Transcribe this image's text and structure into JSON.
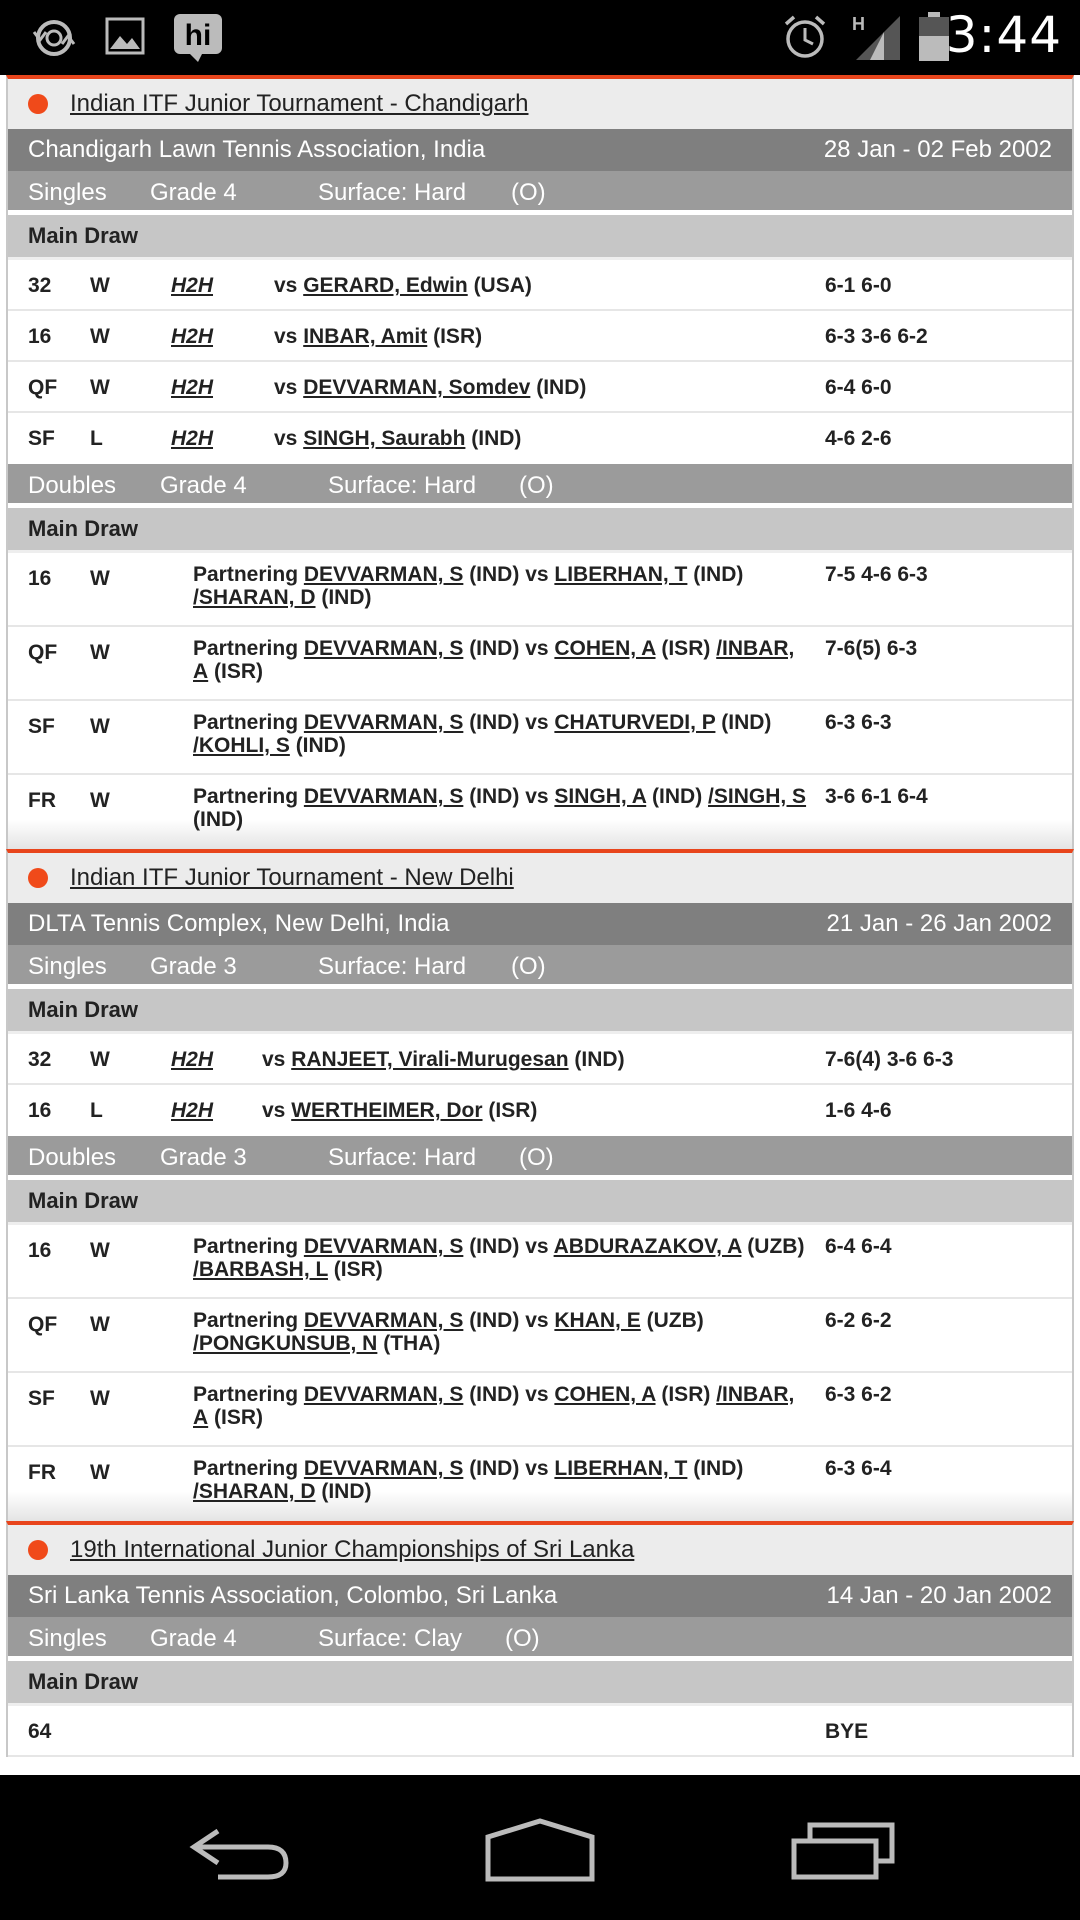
{
  "status_bar": {
    "time": "3:44",
    "signal_label": "H",
    "icons": [
      "sync-icon",
      "gallery-icon",
      "hi-app-icon",
      "alarm-icon",
      "signal-icon",
      "battery-icon"
    ]
  },
  "tournaments": [
    {
      "title": "Indian ITF Junior Tournament - Chandigarh",
      "venue": "Chandigarh Lawn Tennis Association, India",
      "dates": "28 Jan - 02 Feb 2002",
      "singles": {
        "event": "Singles",
        "grade": "Grade 4",
        "surface": "Surface: Hard",
        "io": "(O)",
        "draw": "Main Draw",
        "matches": [
          {
            "round": "32",
            "result": "W",
            "h2h": "H2H",
            "vs": "vs",
            "opponent": "GERARD, Edwin",
            "country": "(USA)",
            "score": "6-1 6-0"
          },
          {
            "round": "16",
            "result": "W",
            "h2h": "H2H",
            "vs": "vs",
            "opponent": "INBAR, Amit",
            "country": "(ISR)",
            "score": "6-3 3-6 6-2"
          },
          {
            "round": "QF",
            "result": "W",
            "h2h": "H2H",
            "vs": "vs",
            "opponent": "DEVVARMAN, Somdev",
            "country": "(IND)",
            "score": "6-4 6-0"
          },
          {
            "round": "SF",
            "result": "L",
            "h2h": "H2H",
            "vs": "vs",
            "opponent": "SINGH, Saurabh",
            "country": "(IND)",
            "score": "4-6 2-6"
          }
        ]
      },
      "doubles": {
        "event": "Doubles",
        "grade": "Grade 4",
        "surface": "Surface: Hard",
        "io": "(O)",
        "draw": "Main Draw",
        "matches": [
          {
            "round": "16",
            "result": "W",
            "partnering": "Partnering",
            "partner": "DEVVARMAN, S",
            "partner_country": "(IND)",
            "vs": "vs",
            "opp1": "LIBERHAN, T",
            "opp1_country": "(IND)",
            "opp2": "/SHARAN, D",
            "opp2_country": "(IND)",
            "score": "7-5 4-6 6-3"
          },
          {
            "round": "QF",
            "result": "W",
            "partnering": "Partnering",
            "partner": "DEVVARMAN, S",
            "partner_country": "(IND)",
            "vs": "vs",
            "opp1": "COHEN, A",
            "opp1_country": "(ISR)",
            "opp2": "/INBAR, A",
            "opp2_country": "(ISR)",
            "score": "7-6(5) 6-3"
          },
          {
            "round": "SF",
            "result": "W",
            "partnering": "Partnering",
            "partner": "DEVVARMAN, S",
            "partner_country": "(IND)",
            "vs": "vs",
            "opp1": "CHATURVEDI, P",
            "opp1_country": "(IND)",
            "opp2": "/KOHLI, S",
            "opp2_country": "(IND)",
            "score": "6-3 6-3"
          },
          {
            "round": "FR",
            "result": "W",
            "partnering": "Partnering",
            "partner": "DEVVARMAN, S",
            "partner_country": "(IND)",
            "vs": "vs",
            "opp1": "SINGH, A",
            "opp1_country": "(IND)",
            "opp2": "/SINGH, S",
            "opp2_country": "(IND)",
            "score": "3-6 6-1 6-4"
          }
        ]
      }
    },
    {
      "title": "Indian ITF Junior Tournament - New Delhi",
      "venue": "DLTA Tennis Complex, New Delhi, India",
      "dates": "21 Jan - 26 Jan 2002",
      "singles": {
        "event": "Singles",
        "grade": "Grade 3",
        "surface": "Surface: Hard",
        "io": "(O)",
        "draw": "Main Draw",
        "matches": [
          {
            "round": "32",
            "result": "W",
            "h2h": "H2H",
            "vs": "vs",
            "opponent": "RANJEET, Virali-Murugesan",
            "country": "(IND)",
            "score": "7-6(4) 3-6 6-3"
          },
          {
            "round": "16",
            "result": "L",
            "h2h": "H2H",
            "vs": "vs",
            "opponent": "WERTHEIMER, Dor",
            "country": "(ISR)",
            "score": "1-6 4-6"
          }
        ]
      },
      "doubles": {
        "event": "Doubles",
        "grade": "Grade 3",
        "surface": "Surface: Hard",
        "io": "(O)",
        "draw": "Main Draw",
        "matches": [
          {
            "round": "16",
            "result": "W",
            "partnering": "Partnering",
            "partner": "DEVVARMAN, S",
            "partner_country": "(IND)",
            "vs": "vs",
            "opp1": "ABDURAZAKOV, A",
            "opp1_country": "(UZB)",
            "opp2": "/BARBASH, L",
            "opp2_country": "(ISR)",
            "score": "6-4 6-4"
          },
          {
            "round": "QF",
            "result": "W",
            "partnering": "Partnering",
            "partner": "DEVVARMAN, S",
            "partner_country": "(IND)",
            "vs": "vs",
            "opp1": "KHAN, E",
            "opp1_country": "(UZB)",
            "opp2": "/PONGKUNSUB, N",
            "opp2_country": "(THA)",
            "score": "6-2 6-2"
          },
          {
            "round": "SF",
            "result": "W",
            "partnering": "Partnering",
            "partner": "DEVVARMAN, S",
            "partner_country": "(IND)",
            "vs": "vs",
            "opp1": "COHEN, A",
            "opp1_country": "(ISR)",
            "opp2": "/INBAR, A",
            "opp2_country": "(ISR)",
            "score": "6-3 6-2"
          },
          {
            "round": "FR",
            "result": "W",
            "partnering": "Partnering",
            "partner": "DEVVARMAN, S",
            "partner_country": "(IND)",
            "vs": "vs",
            "opp1": "LIBERHAN, T",
            "opp1_country": "(IND)",
            "opp2": "/SHARAN, D",
            "opp2_country": "(IND)",
            "score": "6-3 6-4"
          }
        ]
      }
    },
    {
      "title": "19th International Junior Championships of Sri Lanka",
      "venue": "Sri Lanka Tennis Association, Colombo, Sri Lanka",
      "dates": "14 Jan - 20 Jan 2002",
      "singles": {
        "event": "Singles",
        "grade": "Grade 4",
        "surface": "Surface: Clay",
        "io": "(O)",
        "draw": "Main Draw",
        "matches": [
          {
            "round": "64",
            "result": "",
            "score": "BYE"
          }
        ]
      }
    }
  ],
  "nav_bar": {
    "icons": [
      "back-icon",
      "home-icon",
      "recent-apps-icon"
    ]
  },
  "colors": {
    "accent": "#e8451c",
    "venue_bar": "#7f7f7f",
    "event_bar": "#9b9b9b",
    "draw_bar": "#c6c6c6"
  }
}
